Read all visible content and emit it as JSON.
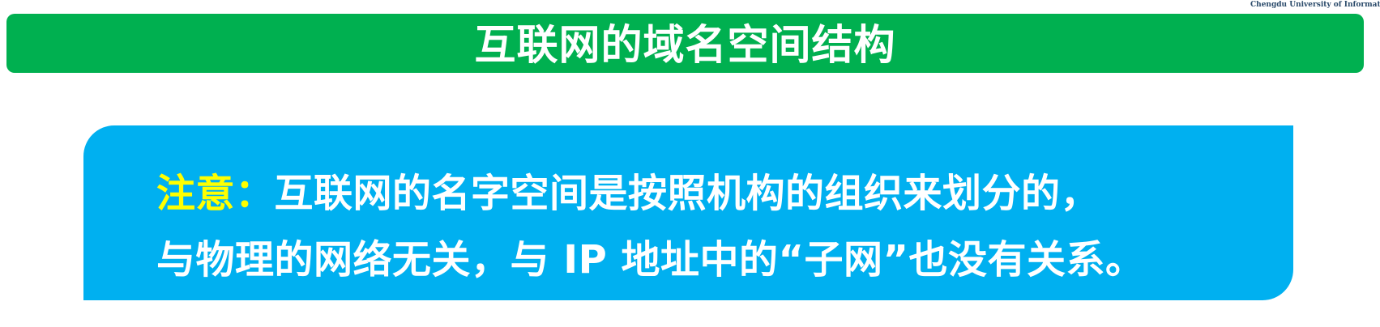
{
  "header": {
    "watermark": "Chengdu University of Information Tec",
    "title": "互联网的域名空间结构"
  },
  "note": {
    "label": "注意：",
    "line1": "互联网的名字空间是按照机构的组织来划分的，",
    "line2": "与物理的网络无关，与 IP 地址中的“子网”也没有关系。"
  },
  "colors": {
    "title_bar": "#00b050",
    "note_box": "#00b0f0",
    "note_label": "#ffff00",
    "text": "#ffffff"
  }
}
